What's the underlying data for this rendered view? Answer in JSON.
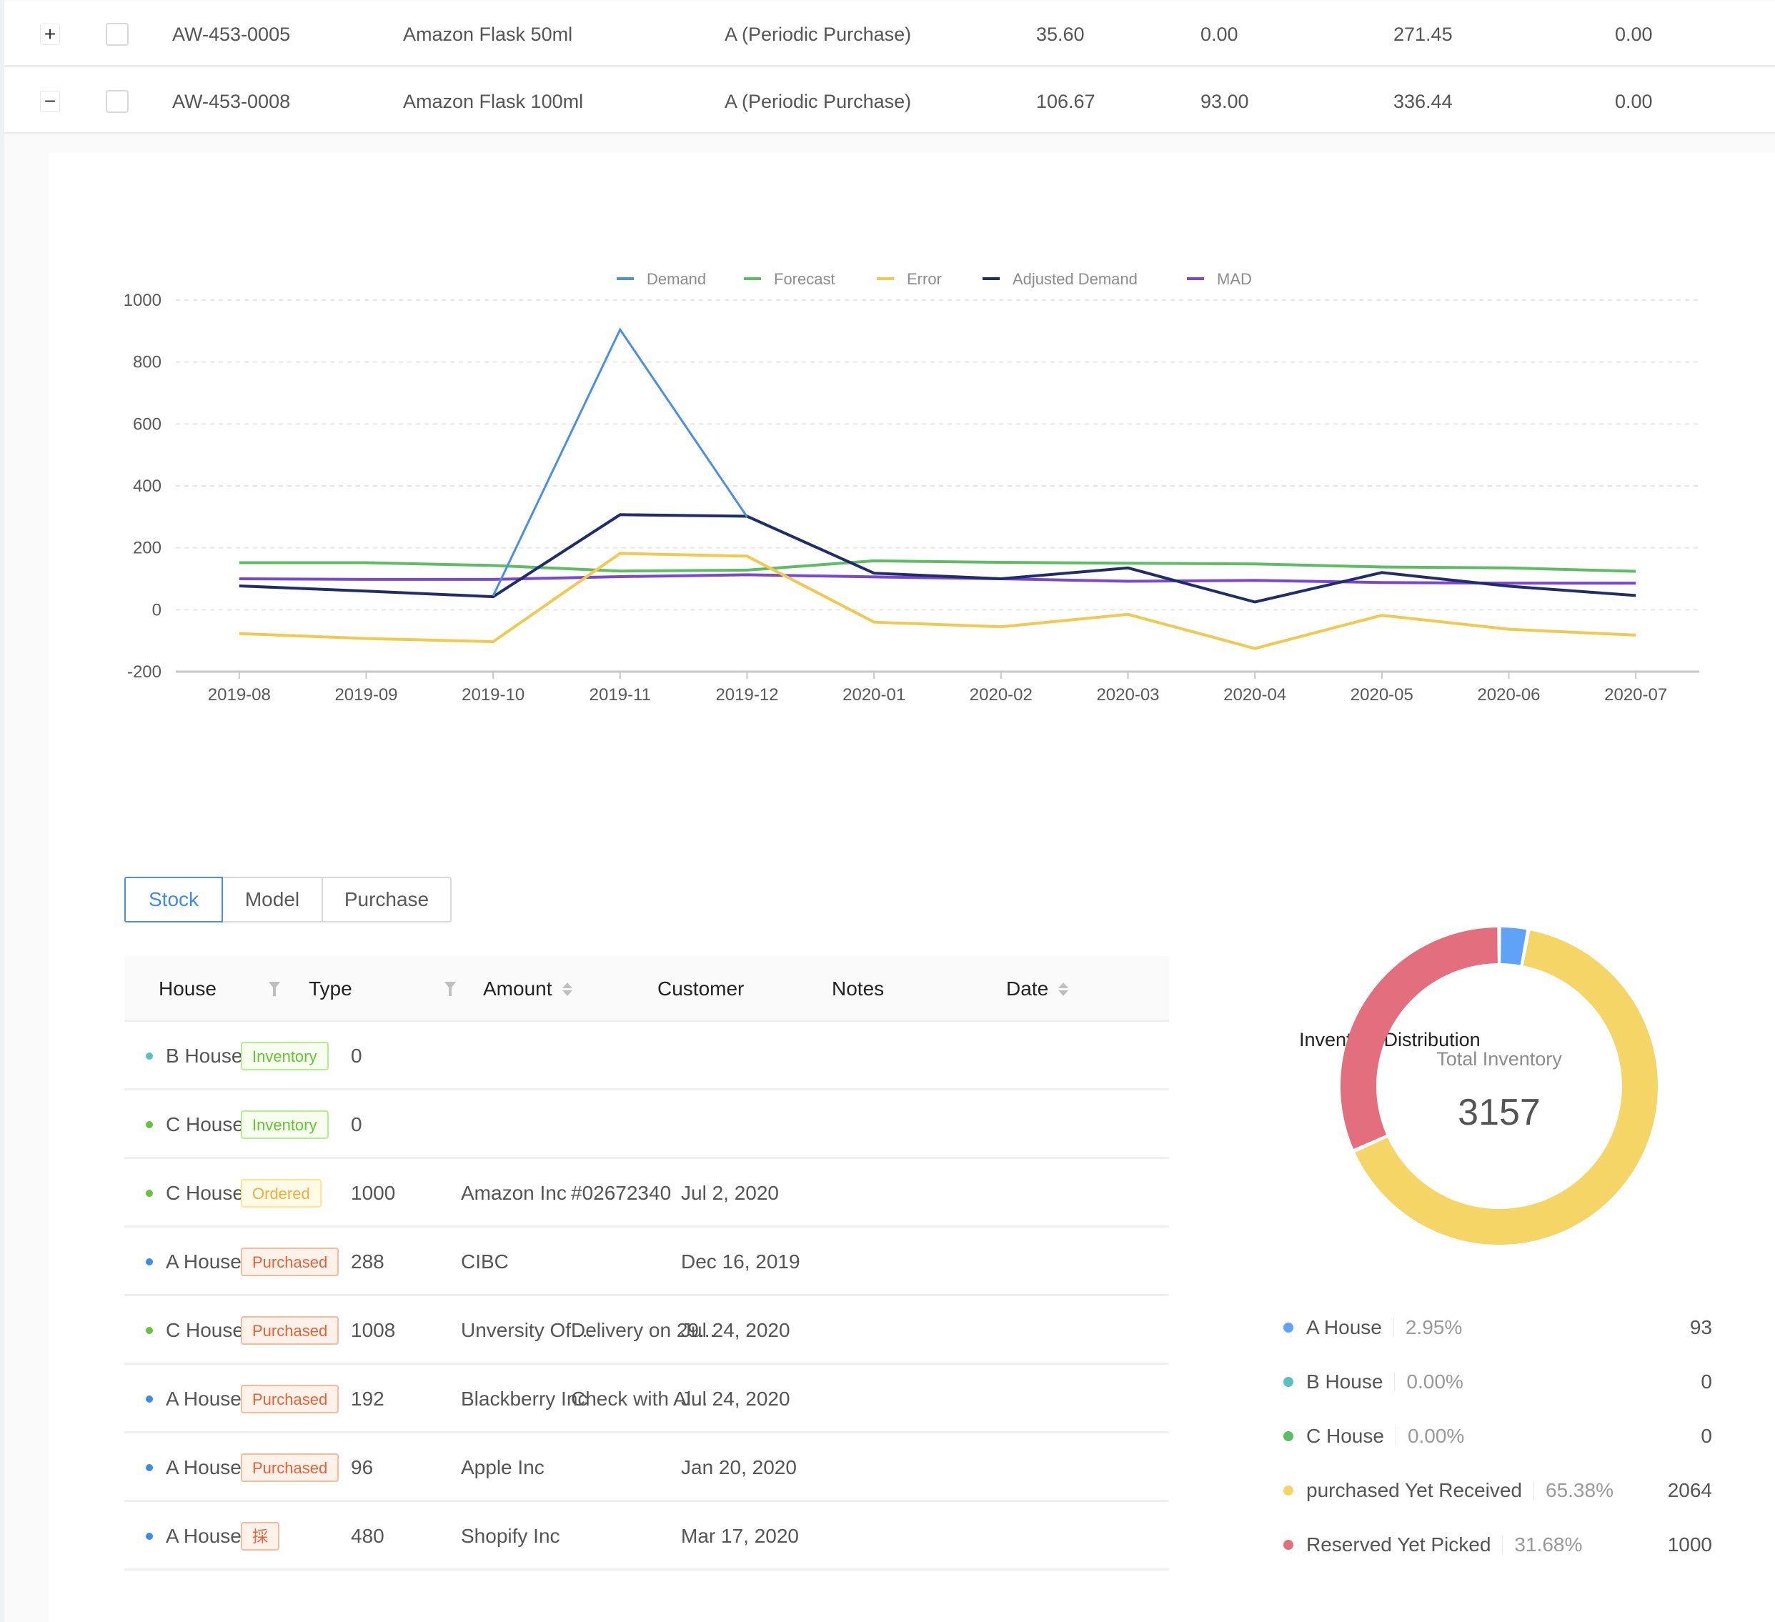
{
  "top_table": {
    "rows": [
      {
        "expand": "+",
        "sku": "AW-453-0005",
        "name": "Amazon Flask 50ml",
        "class": "A (Periodic Purchase)",
        "v1": "35.60",
        "v2": "0.00",
        "v3": "271.45",
        "v4": "0.00"
      },
      {
        "expand": "−",
        "sku": "AW-453-0008",
        "name": "Amazon Flask 100ml",
        "class": "A (Periodic Purchase)",
        "v1": "106.67",
        "v2": "93.00",
        "v3": "336.44",
        "v4": "0.00"
      }
    ]
  },
  "chart_data": {
    "type": "line",
    "title": "",
    "xlabel": "",
    "ylabel": "",
    "x": [
      "2019-08",
      "2019-09",
      "2019-10",
      "2019-11",
      "2019-12",
      "2020-01",
      "2020-02",
      "2020-03",
      "2020-04",
      "2020-05",
      "2020-06",
      "2020-07"
    ],
    "ylim": [
      -200,
      1000
    ],
    "yticks": [
      1000,
      800,
      600,
      400,
      200,
      0,
      -200
    ],
    "grid": true,
    "legend_position": "top-center",
    "series": [
      {
        "name": "Demand",
        "color": "#4a90e2",
        "values": [
          null,
          null,
          45,
          905,
          300,
          null,
          null,
          null,
          null,
          null,
          null,
          null
        ]
      },
      {
        "name": "Forecast",
        "color": "#5cbd62",
        "values": [
          152,
          152,
          143,
          125,
          128,
          158,
          153,
          150,
          148,
          138,
          135,
          124
        ]
      },
      {
        "name": "Error",
        "color": "#f2c94c",
        "values": [
          -77,
          -93,
          -103,
          182,
          173,
          -40,
          -55,
          -15,
          -125,
          -18,
          -63,
          -82
        ]
      },
      {
        "name": "Adjusted Demand",
        "color": "#1f2d6b",
        "values": [
          77,
          60,
          42,
          307,
          302,
          118,
          100,
          135,
          25,
          120,
          76,
          46
        ]
      },
      {
        "name": "MAD",
        "color": "#7b45d8",
        "values": [
          100,
          98,
          98,
          107,
          113,
          106,
          100,
          92,
          95,
          88,
          86,
          86
        ]
      }
    ]
  },
  "tabs": [
    {
      "label": "Stock",
      "active": true
    },
    {
      "label": "Model",
      "active": false
    },
    {
      "label": "Purchase",
      "active": false
    }
  ],
  "stock_table": {
    "headers": {
      "house": "House",
      "type": "Type",
      "amount": "Amount",
      "customer": "Customer",
      "notes": "Notes",
      "date": "Date"
    },
    "rows": [
      {
        "house": "B House",
        "house_color": "#5bc0c0",
        "type": "Inventory",
        "type_style": "inventory",
        "amount": "0",
        "customer": "",
        "notes": "",
        "date": ""
      },
      {
        "house": "C House",
        "house_color": "#67c23a",
        "type": "Inventory",
        "type_style": "inventory",
        "amount": "0",
        "customer": "",
        "notes": "",
        "date": ""
      },
      {
        "house": "C House",
        "house_color": "#67c23a",
        "type": "Ordered",
        "type_style": "ordered",
        "amount": "1000",
        "customer": "Amazon Inc",
        "notes": "#02672340",
        "date": "Jul 2, 2020"
      },
      {
        "house": "A House",
        "house_color": "#3d8ce8",
        "type": "Purchased",
        "type_style": "purchased",
        "amount": "288",
        "customer": "CIBC",
        "notes": "",
        "date": "Dec 16, 2019"
      },
      {
        "house": "C House",
        "house_color": "#67c23a",
        "type": "Purchased",
        "type_style": "purchased",
        "amount": "1008",
        "customer": "Unversity Of ...",
        "notes": "Delivery on 29...",
        "date": "Jul 24, 2020"
      },
      {
        "house": "A House",
        "house_color": "#3d8ce8",
        "type": "Purchased",
        "type_style": "purchased",
        "amount": "192",
        "customer": "Blackberry Inc",
        "notes": "Check with Al...",
        "date": "Jul 24, 2020"
      },
      {
        "house": "A House",
        "house_color": "#3d8ce8",
        "type": "Purchased",
        "type_style": "purchased",
        "amount": "96",
        "customer": "Apple Inc",
        "notes": "",
        "date": "Jan 20, 2020"
      },
      {
        "house": "A House",
        "house_color": "#3d8ce8",
        "type": "採",
        "type_style": "purchased",
        "amount": "480",
        "customer": "Shopify Inc",
        "notes": "",
        "date": "Mar 17, 2020"
      }
    ]
  },
  "inventory_distribution": {
    "title": "Inventory Distribution",
    "center_label": "Total Inventory",
    "total": "3157",
    "items": [
      {
        "name": "A House",
        "percent": "2.95%",
        "value": "93",
        "color": "#5ea3f7"
      },
      {
        "name": "B House",
        "percent": "0.00%",
        "value": "0",
        "color": "#5bc0c0"
      },
      {
        "name": "C House",
        "percent": "0.00%",
        "value": "0",
        "color": "#5cbd62"
      },
      {
        "name": "purchased Yet Received",
        "percent": "65.38%",
        "value": "2064",
        "color": "#f4d565"
      },
      {
        "name": "Reserved Yet Picked",
        "percent": "31.68%",
        "value": "1000",
        "color": "#e26e7e"
      }
    ]
  }
}
